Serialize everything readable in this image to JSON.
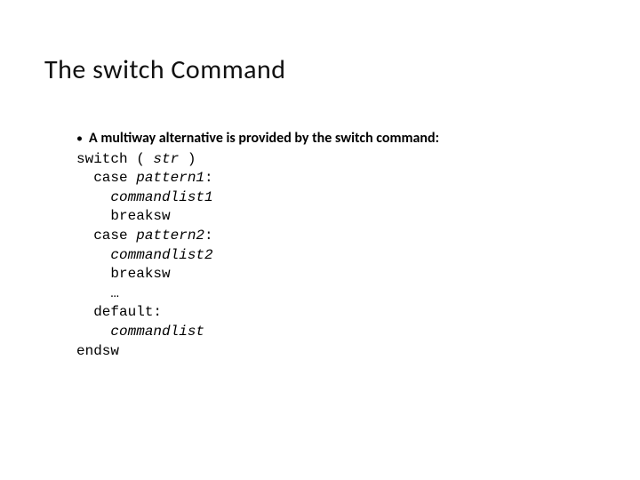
{
  "title": "The switch Command",
  "bullet": "A multiway alternative is provided by the switch command:",
  "code": {
    "l1a": "switch ( ",
    "l1b": "str",
    "l1c": " )",
    "l2a": "  case ",
    "l2b": "pattern1",
    "l2c": ":",
    "l3a": "    ",
    "l3b": "commandlist1",
    "l4": "    breaksw",
    "l5a": "  case ",
    "l5b": "pattern2",
    "l5c": ":",
    "l6a": "    ",
    "l6b": "commandlist2",
    "l7": "    breaksw",
    "l8": "    …",
    "l9": "  default:",
    "l10a": "    ",
    "l10b": "commandlist",
    "l11": "endsw"
  }
}
